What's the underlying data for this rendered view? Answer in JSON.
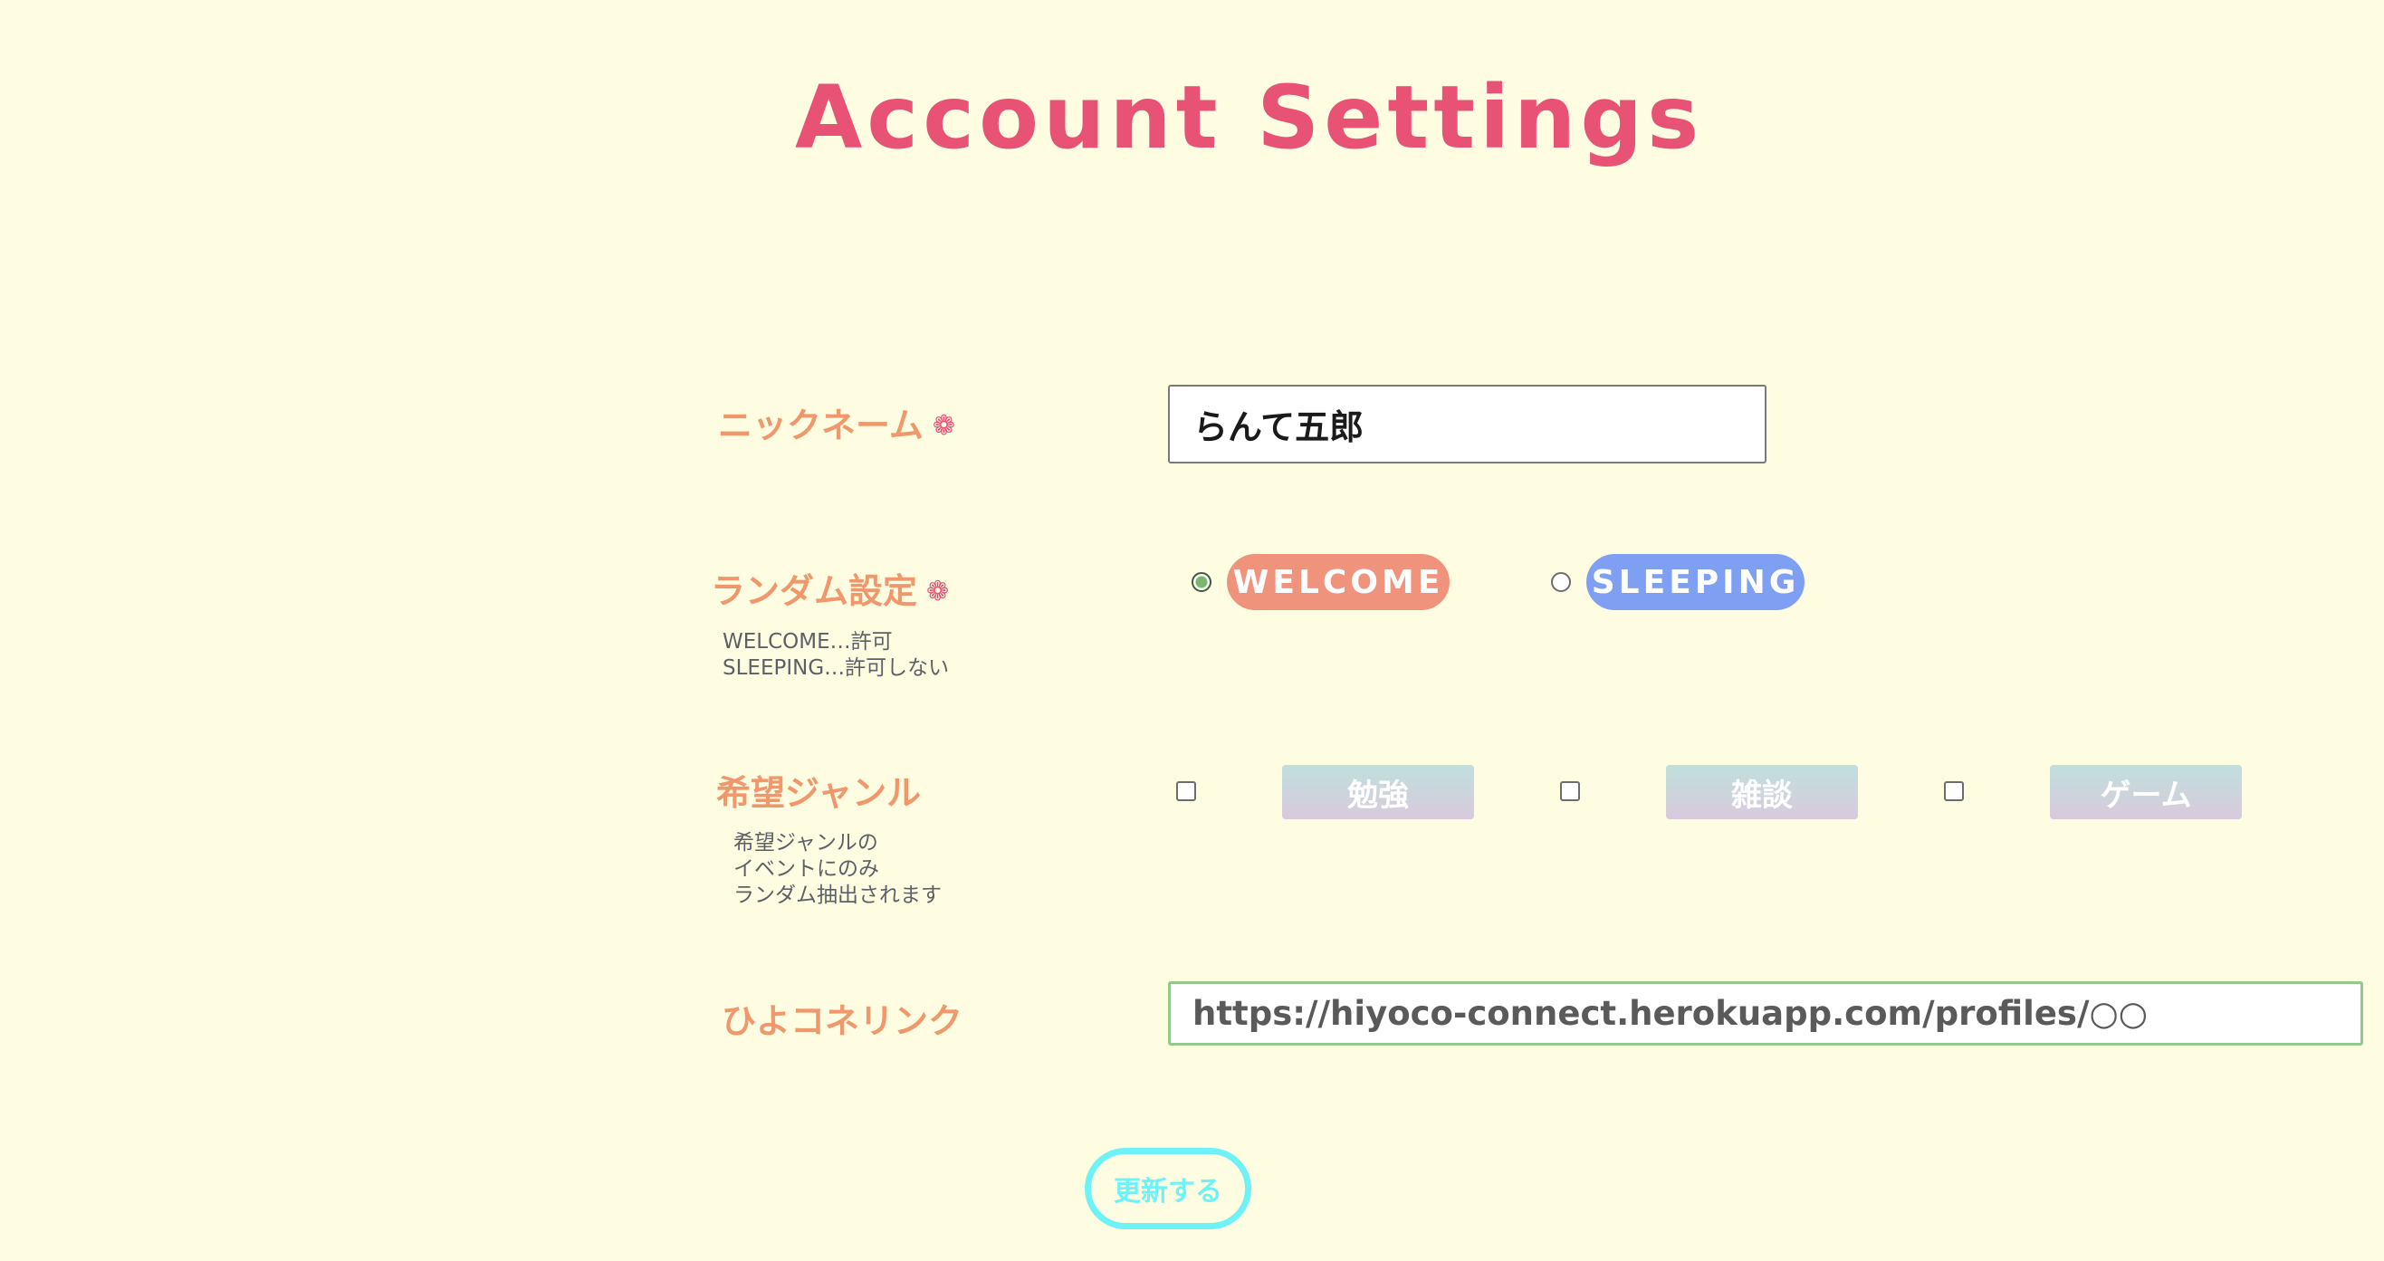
{
  "title": "Account Settings",
  "required_mark": "❁",
  "nickname": {
    "label": "ニックネーム",
    "value": "らんて五郎"
  },
  "random_setting": {
    "label": "ランダム設定",
    "note": [
      "WELCOME…許可",
      "SLEEPING…許可しない"
    ],
    "options": [
      {
        "label": "WELCOME",
        "checked": true,
        "color": "#f0937d"
      },
      {
        "label": "SLEEPING",
        "checked": false,
        "color": "#7f9ff2"
      }
    ]
  },
  "genre": {
    "label": "希望ジャンル",
    "note": [
      "希望ジャンルの",
      "イベントにのみ",
      "ランダム抽出されます"
    ],
    "options": [
      {
        "label": "勉強",
        "checked": false
      },
      {
        "label": "雑談",
        "checked": false
      },
      {
        "label": "ゲーム",
        "checked": false
      }
    ]
  },
  "hiyoco_link": {
    "label": "ひよコネリンク",
    "placeholder": "https://hiyoco-connect.herokuapp.com/profiles/○○"
  },
  "submit": {
    "label": "更新する"
  },
  "colors": {
    "background": "#fefde2",
    "title": "#e85275",
    "label": "#f0976c",
    "required": "#e85275",
    "submit": "#6ef2f6",
    "url_border": "#94c98c"
  }
}
